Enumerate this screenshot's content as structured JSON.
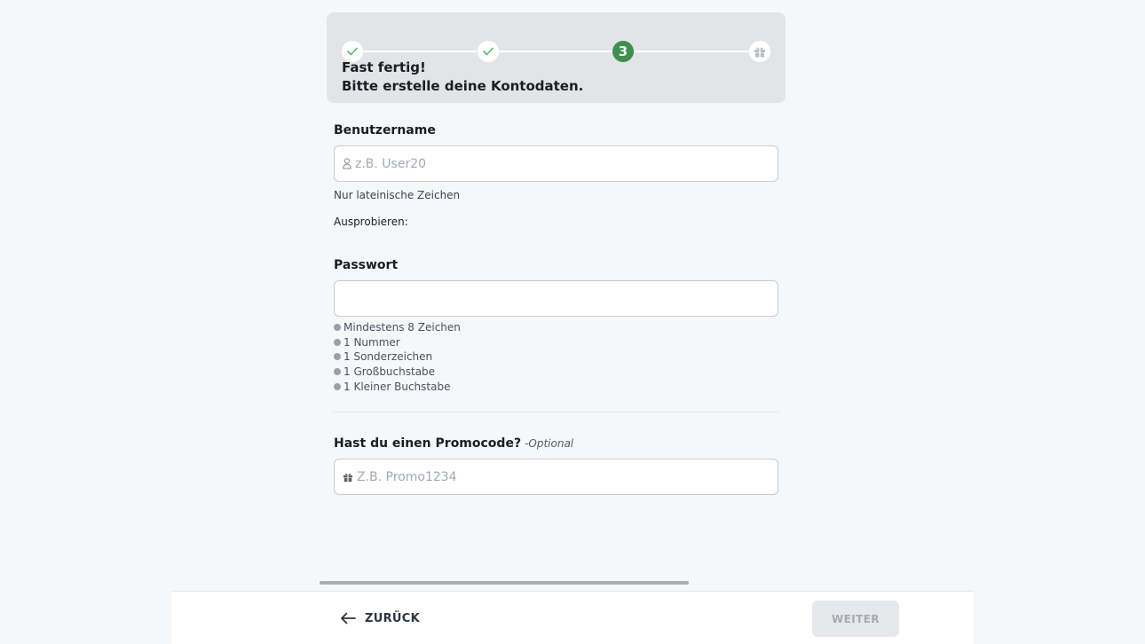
{
  "stepper": {
    "current_step": "3",
    "title_line1": "Fast fertig!",
    "title_line2": "Bitte erstelle deine Kontodaten."
  },
  "username": {
    "label": "Benutzername",
    "placeholder": "z.B. User20",
    "value": "",
    "hint": "Nur lateinische Zeichen",
    "try_label": "Ausprobieren:"
  },
  "password": {
    "label": "Passwort",
    "value": "",
    "rules": [
      "Mindestens 8 Zeichen",
      "1 Nummer",
      "1 Sonderzeichen",
      "1 Großbuchstabe",
      "1 Kleiner Buchstabe"
    ]
  },
  "promo": {
    "label": "Hast du einen Promocode?",
    "optional_tag": "-Optional",
    "placeholder": "Z.B. Promo1234",
    "value": ""
  },
  "footer": {
    "back_label": "ZURÜCK",
    "next_label": "WEITER"
  },
  "colors": {
    "accent_green": "#3f8f4d",
    "check_green": "#5cb86a",
    "card_bg": "#e2e4e8",
    "disabled_button": "#e6e8eb"
  }
}
